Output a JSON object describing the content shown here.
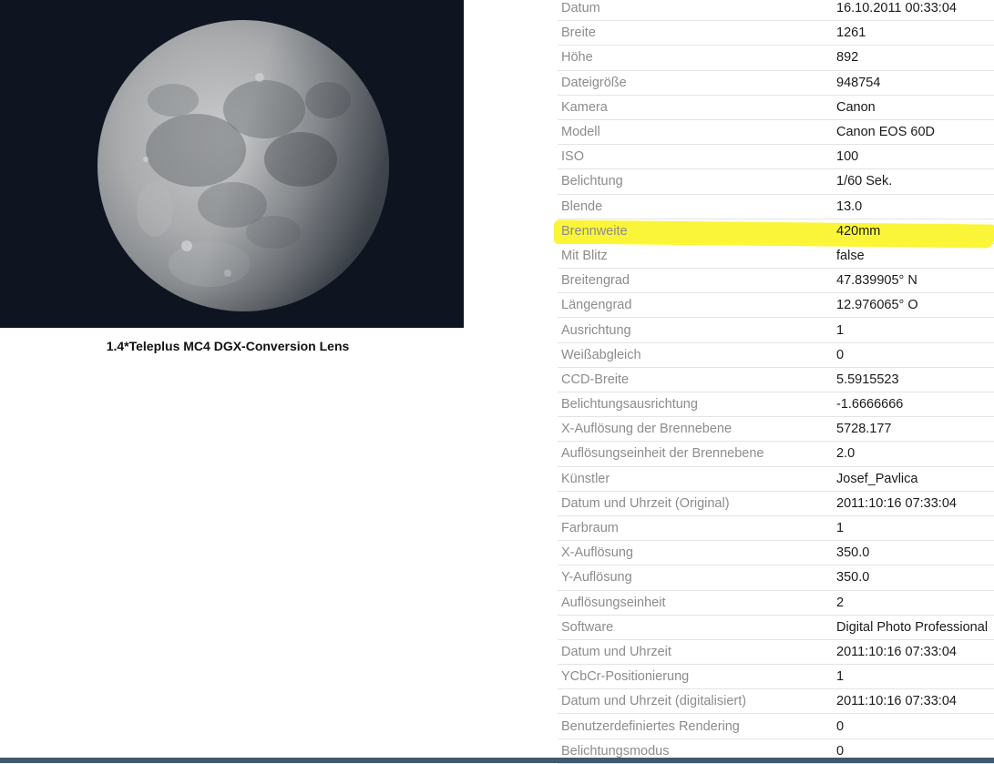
{
  "caption": "1.4*Teleplus MC4 DGX-Conversion Lens",
  "colors": {
    "highlight": "#fbf53a",
    "key_text": "#8c8c8c",
    "value_text": "#1a1a1a",
    "photo_background": "#0e1520",
    "bottom_bar": "#3f5a6e"
  },
  "highlighted_row": "Brennweite",
  "exif": [
    {
      "key": "Datum",
      "value": "16.10.2011 00:33:04"
    },
    {
      "key": "Breite",
      "value": "1261"
    },
    {
      "key": "Höhe",
      "value": "892"
    },
    {
      "key": "Dateigröße",
      "value": "948754"
    },
    {
      "key": "Kamera",
      "value": "Canon"
    },
    {
      "key": "Modell",
      "value": "Canon EOS 60D"
    },
    {
      "key": "ISO",
      "value": "100"
    },
    {
      "key": "Belichtung",
      "value": "1/60 Sek."
    },
    {
      "key": "Blende",
      "value": "13.0"
    },
    {
      "key": "Brennweite",
      "value": "420mm"
    },
    {
      "key": "Mit Blitz",
      "value": "false"
    },
    {
      "key": "Breitengrad",
      "value": "47.839905° N"
    },
    {
      "key": "Längengrad",
      "value": "12.976065° O"
    },
    {
      "key": "Ausrichtung",
      "value": "1"
    },
    {
      "key": "Weißabgleich",
      "value": "0"
    },
    {
      "key": "CCD-Breite",
      "value": "5.5915523"
    },
    {
      "key": "Belichtungsausrichtung",
      "value": "-1.6666666"
    },
    {
      "key": "X-Auflösung der Brennebene",
      "value": "5728.177"
    },
    {
      "key": "Auflösungseinheit der Brennebene",
      "value": "2.0"
    },
    {
      "key": "Künstler",
      "value": "Josef_Pavlica"
    },
    {
      "key": "Datum und Uhrzeit (Original)",
      "value": "2011:10:16 07:33:04"
    },
    {
      "key": "Farbraum",
      "value": "1"
    },
    {
      "key": "X-Auflösung",
      "value": "350.0"
    },
    {
      "key": "Y-Auflösung",
      "value": "350.0"
    },
    {
      "key": "Auflösungseinheit",
      "value": "2"
    },
    {
      "key": "Software",
      "value": "Digital Photo Professional"
    },
    {
      "key": "Datum und Uhrzeit",
      "value": "2011:10:16 07:33:04"
    },
    {
      "key": "YCbCr-Positionierung",
      "value": "1"
    },
    {
      "key": "Datum und Uhrzeit (digitalisiert)",
      "value": "2011:10:16 07:33:04"
    },
    {
      "key": "Benutzerdefiniertes Rendering",
      "value": "0"
    },
    {
      "key": "Belichtungsmodus",
      "value": "0"
    }
  ]
}
